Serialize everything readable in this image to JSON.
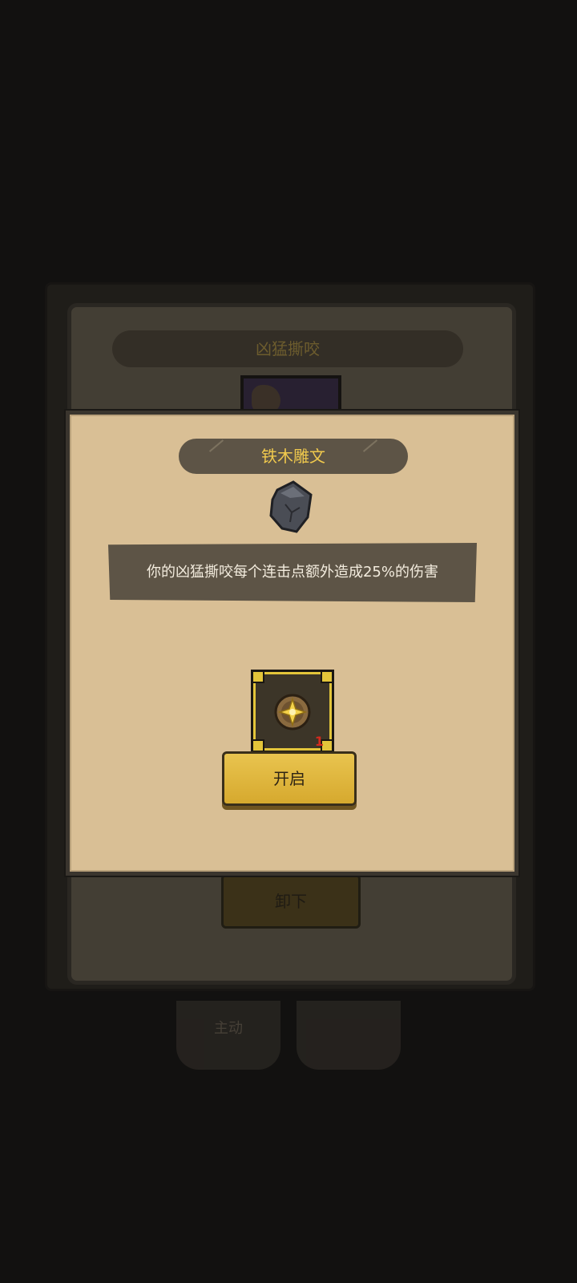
{
  "background": {
    "panel_title": "凶猛撕咬",
    "unequip_label": "卸下",
    "tabs": [
      "主动",
      ""
    ]
  },
  "modal": {
    "title": "铁木雕文",
    "description": "你的凶猛撕咬每个连击点额外造成25%的伤害",
    "item": {
      "count": "1",
      "icon": "glowing-orb-icon"
    },
    "open_label": "开启"
  },
  "colors": {
    "accent_gold": "#f0c94d",
    "modal_bg": "#d9bf95",
    "dark_banner": "#5d5446",
    "count_red": "#d42a1e"
  }
}
